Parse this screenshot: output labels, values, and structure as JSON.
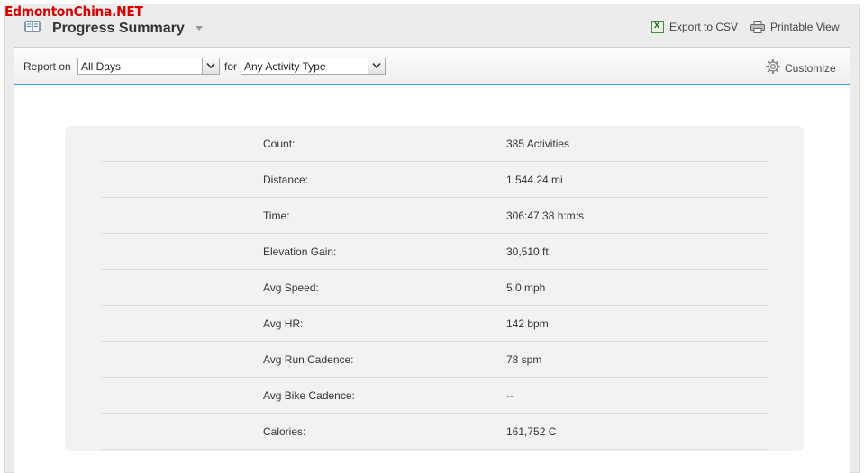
{
  "watermark": "EdmontonChina.NET",
  "header": {
    "title": "Progress Summary",
    "export_label": "Export to CSV",
    "print_label": "Printable View"
  },
  "toolbar": {
    "report_on_label": "Report on",
    "report_on_value": "All Days",
    "for_label": "for",
    "activity_type_value": "Any Activity Type",
    "customize_label": "Customize"
  },
  "summary": {
    "rows": [
      {
        "label": "Count:",
        "value": "385 Activities"
      },
      {
        "label": "Distance:",
        "value": "1,544.24 mi"
      },
      {
        "label": "Time:",
        "value": "306:47:38 h:m:s"
      },
      {
        "label": "Elevation Gain:",
        "value": "30,510 ft"
      },
      {
        "label": "Avg Speed:",
        "value": "5.0 mph"
      },
      {
        "label": "Avg HR:",
        "value": "142 bpm"
      },
      {
        "label": "Avg Run Cadence:",
        "value": "78 spm"
      },
      {
        "label": "Avg Bike Cadence:",
        "value": "--"
      },
      {
        "label": "Calories:",
        "value": "161,752 C"
      }
    ]
  },
  "colors": {
    "accent": "#35a3d8",
    "watermark": "#d40000"
  },
  "icons": [
    "book-icon",
    "title-caret-icon",
    "excel-icon",
    "printer-icon",
    "chevron-down-icon",
    "gear-icon"
  ]
}
